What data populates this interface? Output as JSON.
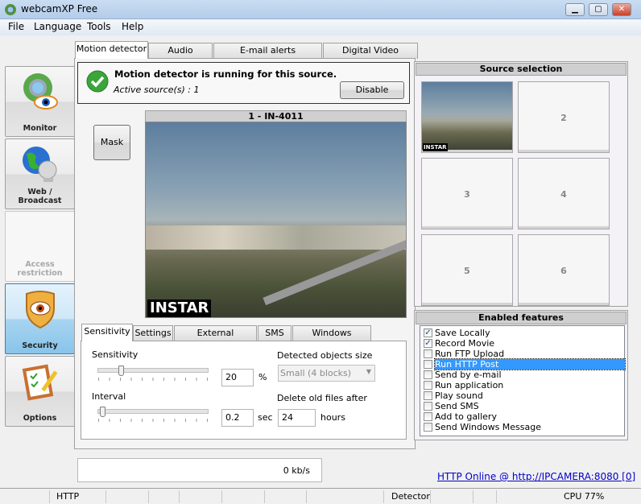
{
  "window": {
    "title": "webcamXP Free",
    "controls": [
      "minimize",
      "maximize",
      "close"
    ]
  },
  "menu": [
    "File",
    "Language",
    "Tools",
    "Help"
  ],
  "sidebar": [
    {
      "label": "Monitor",
      "icon": "webcam-eye-icon",
      "state": "normal"
    },
    {
      "label": "Web / Broadcast",
      "icon": "globe-satellite-icon",
      "state": "normal"
    },
    {
      "label": "Access restriction",
      "icon": "",
      "state": "disabled"
    },
    {
      "label": "Security",
      "icon": "shield-eye-icon",
      "state": "selected"
    },
    {
      "label": "Options",
      "icon": "clipboard-checklist-icon",
      "state": "normal"
    }
  ],
  "tabs": [
    "Motion detector",
    "Audio detector",
    "E-mail alerts configuration",
    "Digital Video Recording"
  ],
  "status": {
    "message": "Motion detector is running for this source.",
    "active": "Active source(s) : 1",
    "disable_label": "Disable"
  },
  "mask_label": "Mask",
  "video": {
    "title": "1 - IN-4011",
    "logo": "INSTAR"
  },
  "subtabs": [
    "Sensitivity",
    "Settings",
    "External application",
    "SMS",
    "Windows Message"
  ],
  "sensitivity": {
    "sensitivity_label": "Sensitivity",
    "sensitivity_value": "20",
    "sensitivity_unit": "%",
    "sensitivity_level": 20,
    "interval_label": "Interval",
    "interval_value": "0.2",
    "interval_unit": "sec",
    "interval_level": 2,
    "objects_label": "Detected objects size",
    "objects_value": "Small (4 blocks)",
    "delete_label": "Delete old files after",
    "delete_value": "24",
    "delete_unit": "hours"
  },
  "source_selection": {
    "title": "Source selection",
    "cells": [
      "",
      "2",
      "3",
      "4",
      "5",
      "6"
    ],
    "thumb_logo": "INSTAR"
  },
  "features": {
    "title": "Enabled features",
    "items": [
      {
        "label": "Save Locally",
        "checked": true
      },
      {
        "label": "Record Movie",
        "checked": true
      },
      {
        "label": "Run FTP Upload",
        "checked": false
      },
      {
        "label": "Run HTTP Post",
        "checked": false,
        "highlighted": true
      },
      {
        "label": "Send by e-mail",
        "checked": false
      },
      {
        "label": "Run application",
        "checked": false
      },
      {
        "label": "Play sound",
        "checked": false
      },
      {
        "label": "Send SMS",
        "checked": false
      },
      {
        "label": "Add to gallery",
        "checked": false
      },
      {
        "label": "Send Windows Message",
        "checked": false
      }
    ]
  },
  "bandwidth": "0 kb/s",
  "http_link": "HTTP Online @ http://IPCAMERA:8080 [0]",
  "statusbar": {
    "http": "HTTP",
    "detector": "Detector",
    "cpu": "CPU 77%"
  }
}
